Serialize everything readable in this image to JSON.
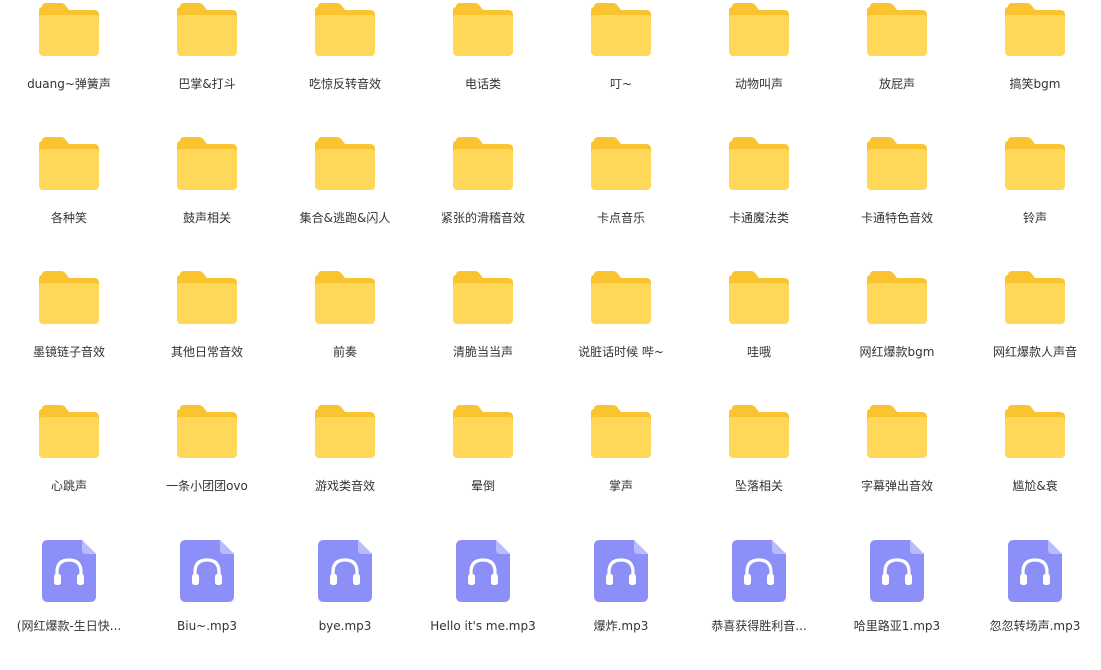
{
  "colors": {
    "folder_back": "#F9C430",
    "folder_front": "#FFD85A",
    "audio_icon": "#8B8FF7",
    "audio_fold": "#B9BCFB",
    "label_text": "#333333"
  },
  "icons": {
    "folder": "folder-icon",
    "audio": "audio-file-icon"
  },
  "items": [
    {
      "type": "folder",
      "name": "duang~弹簧声"
    },
    {
      "type": "folder",
      "name": "巴掌&打斗"
    },
    {
      "type": "folder",
      "name": "吃惊反转音效"
    },
    {
      "type": "folder",
      "name": "电话类"
    },
    {
      "type": "folder",
      "name": "叮~"
    },
    {
      "type": "folder",
      "name": "动物叫声"
    },
    {
      "type": "folder",
      "name": "放屁声"
    },
    {
      "type": "folder",
      "name": "搞笑bgm"
    },
    {
      "type": "folder",
      "name": "各种笑"
    },
    {
      "type": "folder",
      "name": "鼓声相关"
    },
    {
      "type": "folder",
      "name": "集合&逃跑&闪人"
    },
    {
      "type": "folder",
      "name": "紧张的滑稽音效"
    },
    {
      "type": "folder",
      "name": "卡点音乐"
    },
    {
      "type": "folder",
      "name": "卡通魔法类"
    },
    {
      "type": "folder",
      "name": "卡通特色音效"
    },
    {
      "type": "folder",
      "name": "铃声"
    },
    {
      "type": "folder",
      "name": "墨镜链子音效"
    },
    {
      "type": "folder",
      "name": "其他日常音效"
    },
    {
      "type": "folder",
      "name": "前奏"
    },
    {
      "type": "folder",
      "name": "清脆当当声"
    },
    {
      "type": "folder",
      "name": "说脏话时候 哔~"
    },
    {
      "type": "folder",
      "name": "哇哦"
    },
    {
      "type": "folder",
      "name": "网红爆款bgm"
    },
    {
      "type": "folder",
      "name": "网红爆款人声音"
    },
    {
      "type": "folder",
      "name": "心跳声"
    },
    {
      "type": "folder",
      "name": "一条小团团ovo"
    },
    {
      "type": "folder",
      "name": "游戏类音效"
    },
    {
      "type": "folder",
      "name": "晕倒"
    },
    {
      "type": "folder",
      "name": "掌声"
    },
    {
      "type": "folder",
      "name": "坠落相关"
    },
    {
      "type": "folder",
      "name": "字幕弹出音效"
    },
    {
      "type": "folder",
      "name": "尴尬&衰"
    },
    {
      "type": "file",
      "name": "(网红爆款-生日快..."
    },
    {
      "type": "file",
      "name": "Biu~.mp3"
    },
    {
      "type": "file",
      "name": "bye.mp3"
    },
    {
      "type": "file",
      "name": "Hello it's me.mp3"
    },
    {
      "type": "file",
      "name": "爆炸.mp3"
    },
    {
      "type": "file",
      "name": "恭喜获得胜利音..."
    },
    {
      "type": "file",
      "name": "哈里路亚1.mp3"
    },
    {
      "type": "file",
      "name": "忽忽转场声.mp3"
    }
  ]
}
